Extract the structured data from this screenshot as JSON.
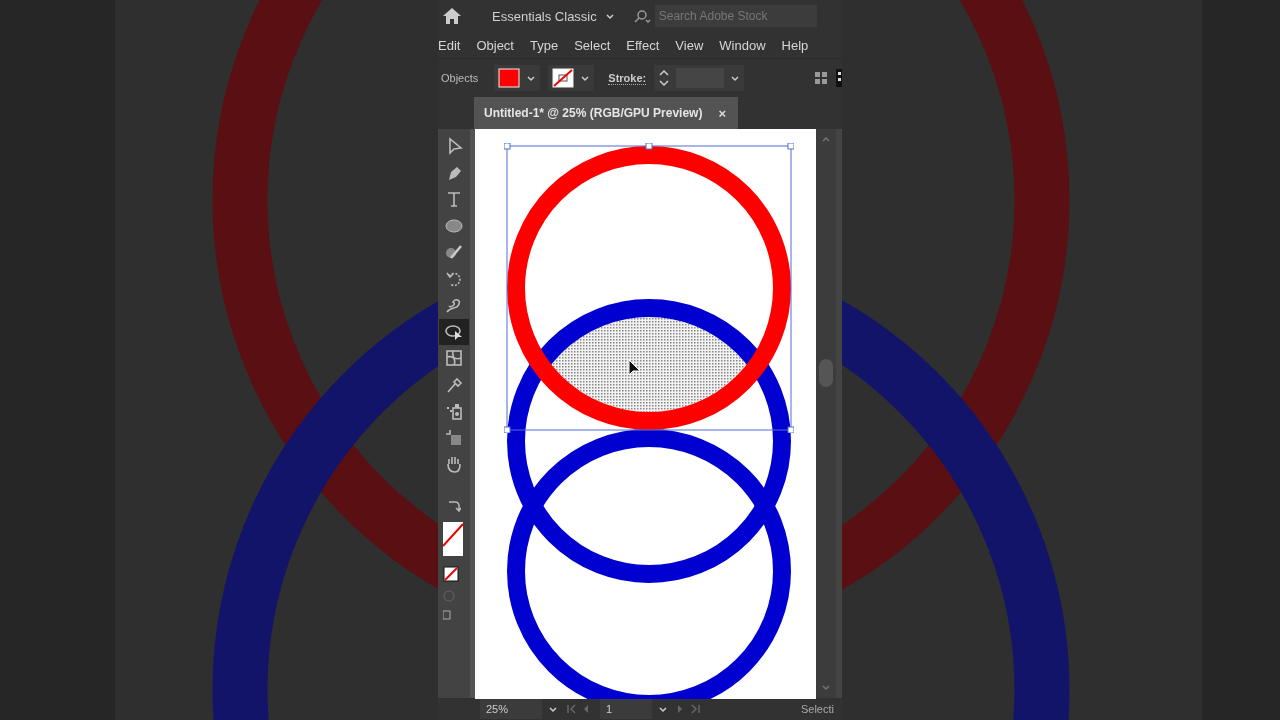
{
  "app_bar": {
    "workspace": "Essentials Classic",
    "search": {
      "placeholder": "Search Adobe Stock"
    }
  },
  "menu": [
    "Edit",
    "Object",
    "Type",
    "Select",
    "Effect",
    "View",
    "Window",
    "Help"
  ],
  "control_bar": {
    "label": "Objects",
    "stroke_label": "Stroke:"
  },
  "document_tab": {
    "title": "Untitled-1* @ 25% (RGB/GPU Preview)",
    "close": "×"
  },
  "tools": [
    {
      "kind": "select",
      "selected": false
    },
    {
      "kind": "pen",
      "selected": false
    },
    {
      "kind": "type",
      "selected": false
    },
    {
      "kind": "ellipse",
      "selected": false
    },
    {
      "kind": "shaper",
      "selected": false
    },
    {
      "kind": "rotate",
      "selected": false
    },
    {
      "kind": "warp",
      "selected": false
    },
    {
      "kind": "builder",
      "selected": true
    },
    {
      "kind": "mesh",
      "selected": false
    },
    {
      "kind": "eyedropper",
      "selected": false
    },
    {
      "kind": "sprayer",
      "selected": false
    },
    {
      "kind": "artboard",
      "selected": false
    },
    {
      "kind": "hand",
      "selected": false
    }
  ],
  "status_bar": {
    "zoom": "25%",
    "page": "1",
    "tool": "Selecti"
  }
}
